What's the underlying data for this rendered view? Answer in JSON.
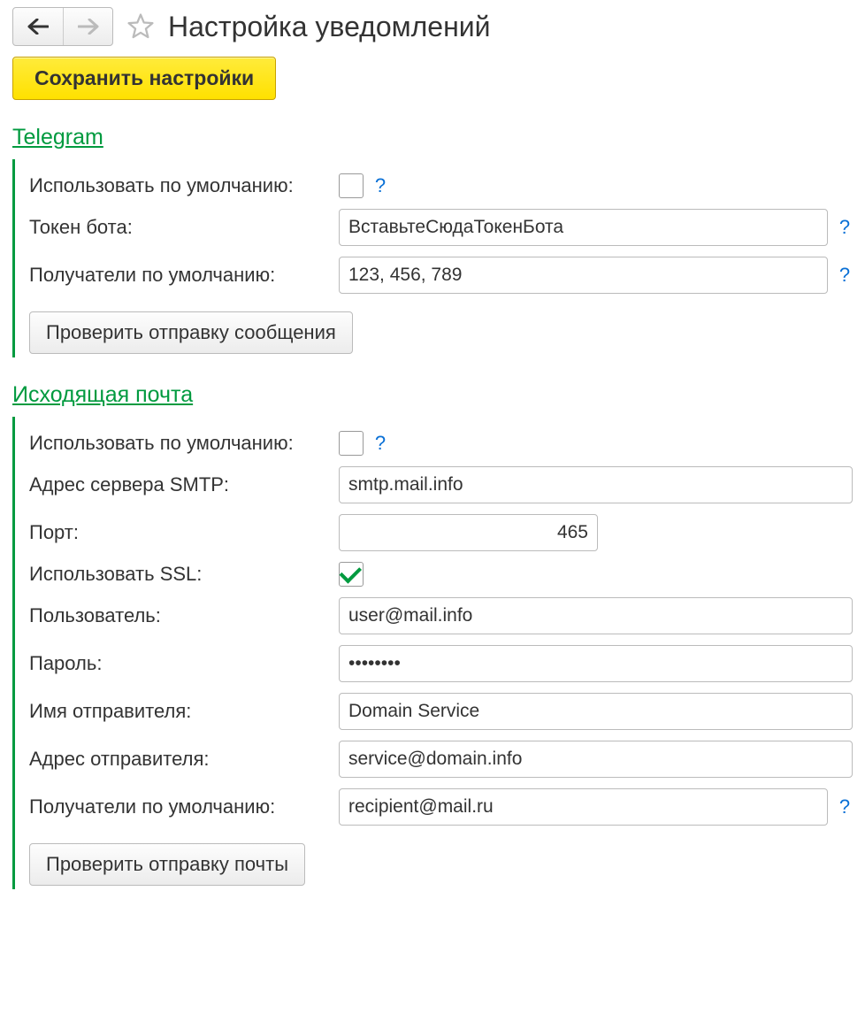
{
  "header": {
    "title": "Настройка уведомлений"
  },
  "save_button": "Сохранить настройки",
  "help_symbol": "?",
  "telegram": {
    "title": "Telegram",
    "use_default_label": "Использовать по умолчанию:",
    "use_default_checked": false,
    "token_label": "Токен бота:",
    "token_value": "ВставьтеСюдаТокенБота",
    "recipients_label": "Получатели по умолчанию:",
    "recipients_value": "123, 456, 789",
    "test_button": "Проверить отправку сообщения"
  },
  "mail": {
    "title": "Исходящая почта",
    "use_default_label": "Использовать по умолчанию:",
    "use_default_checked": false,
    "smtp_label": "Адрес сервера SMTP:",
    "smtp_value": "smtp.mail.info",
    "port_label": "Порт:",
    "port_value": "465",
    "ssl_label": "Использовать SSL:",
    "ssl_checked": true,
    "user_label": "Пользователь:",
    "user_value": "user@mail.info",
    "password_label": "Пароль:",
    "password_value": "••••••••",
    "sender_name_label": "Имя отправителя:",
    "sender_name_value": "Domain Service",
    "sender_addr_label": "Адрес отправителя:",
    "sender_addr_value": "service@domain.info",
    "recipients_label": "Получатели по умолчанию:",
    "recipients_value": "recipient@mail.ru",
    "test_button": "Проверить отправку почты"
  }
}
